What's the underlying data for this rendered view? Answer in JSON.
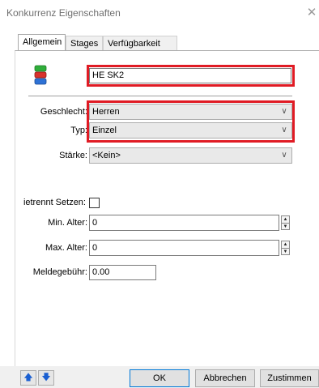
{
  "window": {
    "title": "Konkurrenz Eigenschaften",
    "close_symbol": "✕"
  },
  "tabs": [
    {
      "label": "Allgemein",
      "active": true
    },
    {
      "label": "Stages",
      "active": false
    },
    {
      "label": "Verfügbarkeit",
      "active": false
    }
  ],
  "form": {
    "name_value": "HE SK2",
    "geschlecht": {
      "label": "Geschlecht:",
      "value": "Herren"
    },
    "typ": {
      "label": "Typ:",
      "value": "Einzel"
    },
    "staerke": {
      "label": "Stärke:",
      "value": "<Kein>"
    },
    "getrennt_setzen": {
      "label": "ietrennt Setzen:",
      "checked": false
    },
    "min_alter": {
      "label": "Min. Alter:",
      "value": "0"
    },
    "max_alter": {
      "label": "Max. Alter:",
      "value": "0"
    },
    "meldegebuehr": {
      "label": "Meldegebühr:",
      "value": "0.00"
    }
  },
  "buttons": {
    "up_symbol": "🡅",
    "down_symbol": "🡇",
    "ok": "OK",
    "cancel": "Abbrechen",
    "agree": "Zustimmen"
  },
  "colors": {
    "highlight": "#e01b24",
    "arrow": "#1a5fd1"
  },
  "icons": [
    "stack-icon",
    "close-icon",
    "chevron-down-icon",
    "arrow-up-icon",
    "arrow-down-icon"
  ]
}
